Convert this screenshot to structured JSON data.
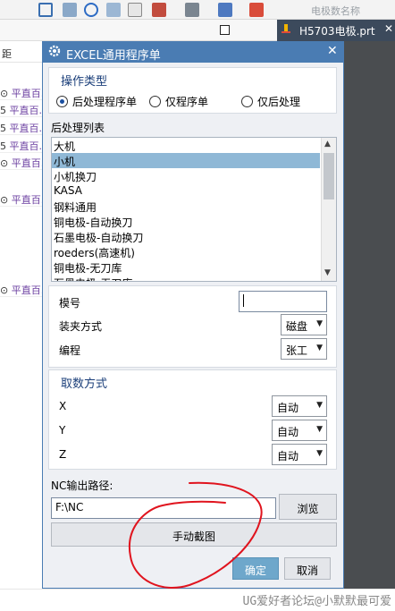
{
  "background": {
    "toolbar_label": "电极数名称",
    "tab_title": "H5703电极.prt",
    "left_column_header": "距",
    "left_rows": [
      {
        "prefix": "⊙",
        "text": "平直百."
      },
      {
        "prefix": "5",
        "text": "平直百."
      },
      {
        "prefix": "5",
        "text": "平直百."
      },
      {
        "prefix": "5",
        "text": "平直百."
      },
      {
        "prefix": "⊙",
        "text": "平直百."
      },
      {
        "prefix": "⊙",
        "text": "平直百."
      },
      {
        "prefix": "⊙",
        "text": "平直百."
      }
    ],
    "watermark": "UG爱好者论坛@小默默最可爱"
  },
  "dialog": {
    "title": "EXCEL通用程序单",
    "operation_group": {
      "title": "操作类型",
      "options": [
        {
          "label": "后处理程序单",
          "selected": true
        },
        {
          "label": "仅程序单",
          "selected": false
        },
        {
          "label": "仅后处理",
          "selected": false
        }
      ]
    },
    "post_list": {
      "label": "后处理列表",
      "items": [
        "大机",
        "小机",
        "小机换刀",
        "KASA",
        "钢料通用",
        "铜电极-自动换刀",
        "石墨电极-自动换刀",
        "roeders(高速机)",
        "铜电极-无刀库",
        "石墨电极-无刀库"
      ],
      "selected_index": 1
    },
    "info_group": {
      "mold_label": "模号",
      "mold_value": "",
      "clamp_label": "装夹方式",
      "clamp_value": "磁盘",
      "programmer_label": "编程",
      "programmer_value": "张工"
    },
    "sampling_group": {
      "title": "取数方式",
      "axes": [
        {
          "label": "X",
          "value": "自动"
        },
        {
          "label": "Y",
          "value": "自动"
        },
        {
          "label": "Z",
          "value": "自动"
        }
      ]
    },
    "nc_output": {
      "label": "NC输出路径:",
      "path": "F:\\NC",
      "browse_label": "浏览",
      "manual_button": "手动截图"
    },
    "ok_label": "确定",
    "cancel_label": "取消"
  },
  "colors": {
    "title_bar": "#4a7cb3",
    "group_title": "#1b3f7a",
    "selection": "#8fb8d6",
    "annotation": "#e0141e"
  }
}
